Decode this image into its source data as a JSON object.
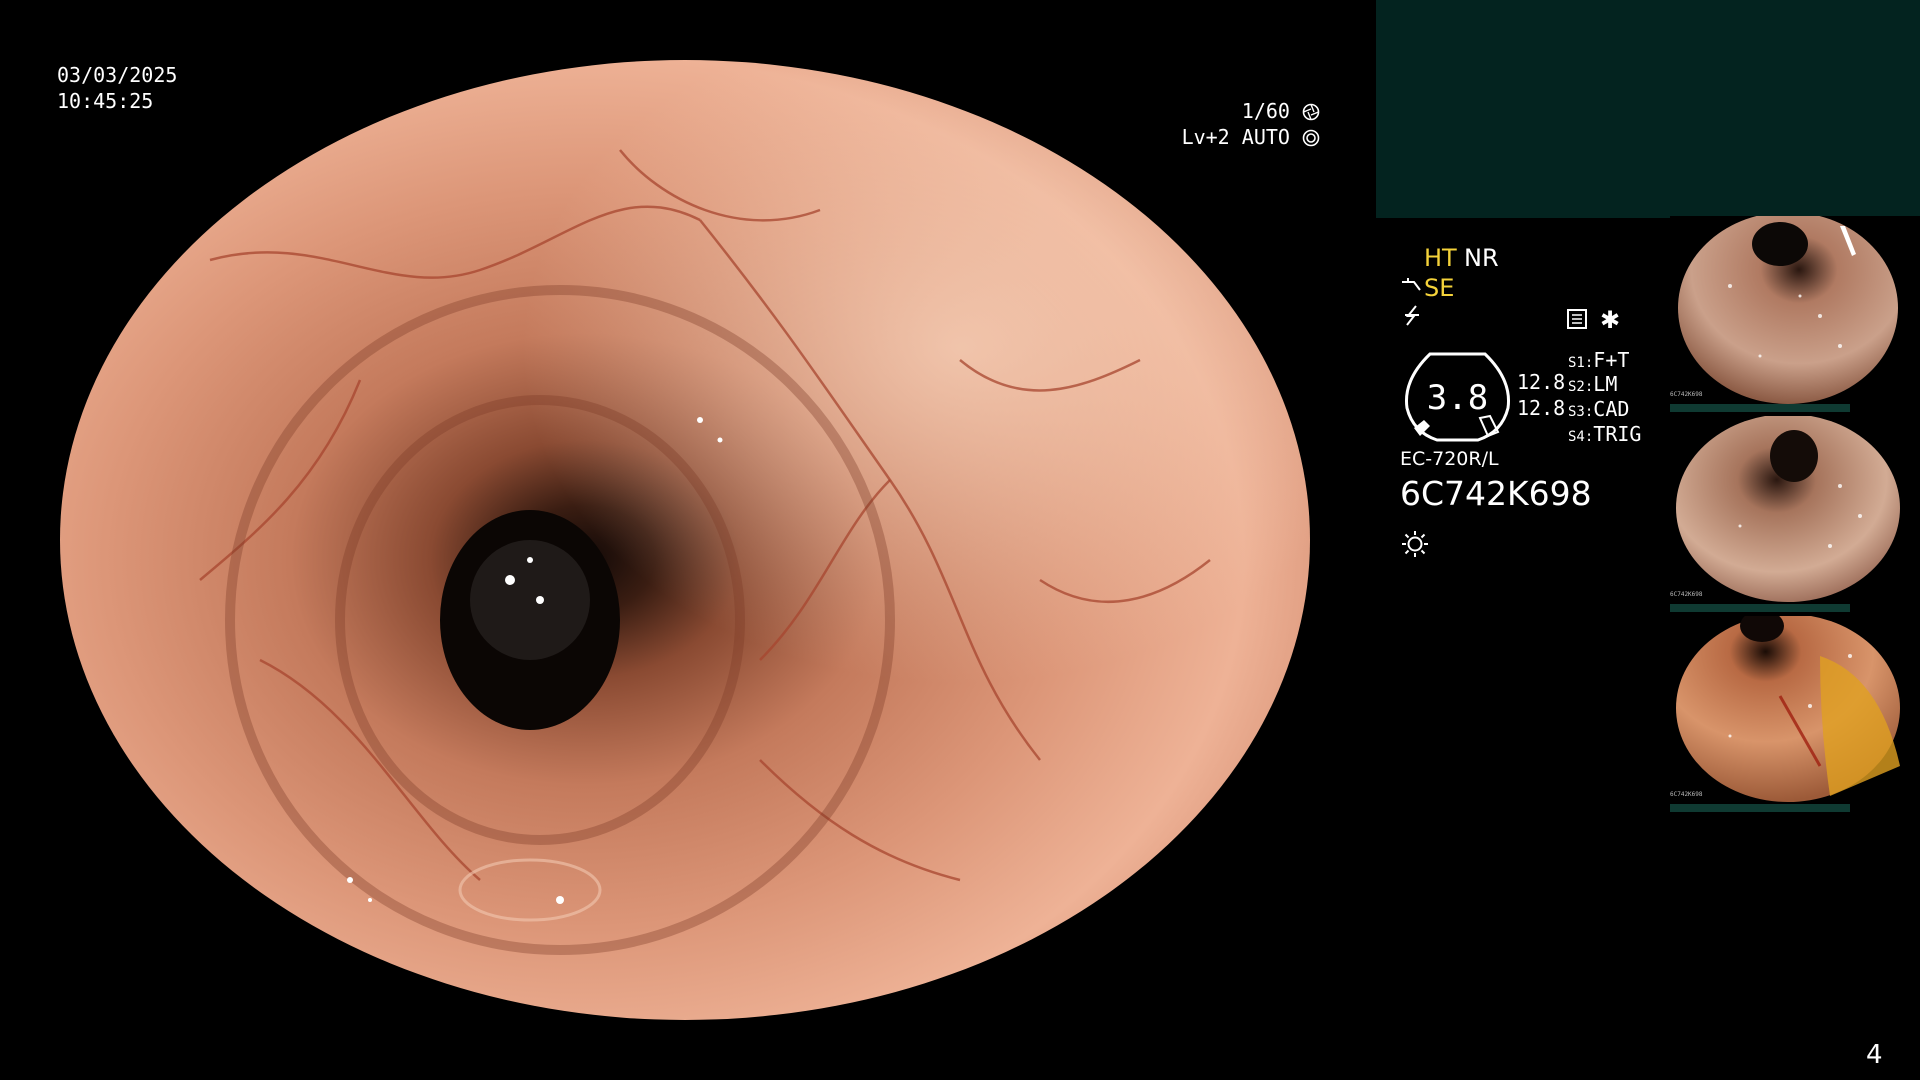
{
  "header": {
    "date": "03/03/2025",
    "time": "10:45:25",
    "shutter": "1/60",
    "level": "Lv+2",
    "mode": "AUTO"
  },
  "status": {
    "ht": "HT",
    "nr": "NR",
    "se": "SE",
    "gauge_value": "3.8",
    "zoom_top": "12.8",
    "zoom_bottom": "12.8",
    "switches": [
      {
        "key": "S1",
        "value": "F+T"
      },
      {
        "key": "S2",
        "value": "LM"
      },
      {
        "key": "S3",
        "value": "CAD"
      },
      {
        "key": "S4",
        "value": "TRIG"
      }
    ],
    "model": "EC-720R/L",
    "serial": "6C742K698"
  },
  "icons": {
    "shutter": "aperture-icon",
    "auto": "iris-icon",
    "scope_tip": "scope-tip-icon",
    "freeze": "lightning-icon",
    "record": "film-record-icon",
    "star": "asterisk-icon",
    "light": "sun-icon"
  },
  "thumbnails": [
    {
      "serial": "6C742K698"
    },
    {
      "serial": "6C742K698"
    },
    {
      "serial": "6C742K698"
    }
  ],
  "page_number": "4",
  "colors": {
    "accent_yellow": "#f4d23a",
    "panel_teal": "#03231f",
    "mucosa": "#d48a6c"
  }
}
